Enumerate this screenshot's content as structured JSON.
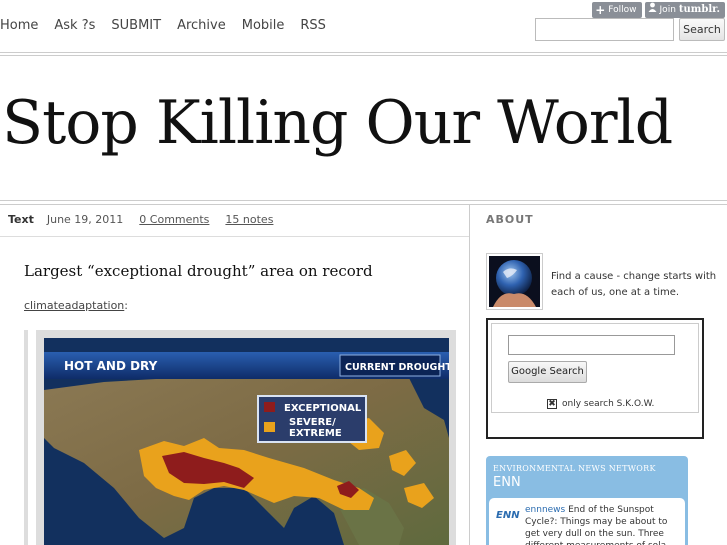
{
  "tumblr": {
    "follow_label": "Follow",
    "join_label": "Join",
    "brand": "tumblr."
  },
  "nav": {
    "items": [
      "Home",
      "Ask ?s",
      "SUBMIT",
      "Archive",
      "Mobile",
      "RSS"
    ]
  },
  "search": {
    "value": "",
    "button_label": "Search"
  },
  "site": {
    "title": "Stop Killing Our World"
  },
  "post": {
    "type": "Text",
    "date": "June 19, 2011",
    "comments": "0 Comments",
    "notes": "15 notes",
    "title": "Largest “exceptional drought” area on record",
    "source": "climateadaptation",
    "source_suffix": ":"
  },
  "map": {
    "header_left": "HOT AND DRY",
    "header_right": "CURRENT DROUGHT",
    "legend": [
      {
        "label": "EXCEPTIONAL",
        "color": "#8e1c1c"
      },
      {
        "label": "SEVERE/ EXTREME",
        "color": "#e9a21c"
      }
    ]
  },
  "sidebar": {
    "about_label": "ABOUT",
    "about_text": "Find a cause - change starts with each of us, one at a time.",
    "google": {
      "input_value": "",
      "button_label": "Google Search",
      "check_mark": "✖",
      "check_label": "only search S.K.O.W."
    },
    "enn": {
      "header_small": "ENVIRONMENTAL NEWS NETWORK",
      "header_big": "ENN",
      "logo": "ENN",
      "item_source": "ennnews",
      "item_text": " End of the Sunspot Cycle?: Things may be about to get very dull on the sun. Three different measurements of sola..."
    }
  }
}
